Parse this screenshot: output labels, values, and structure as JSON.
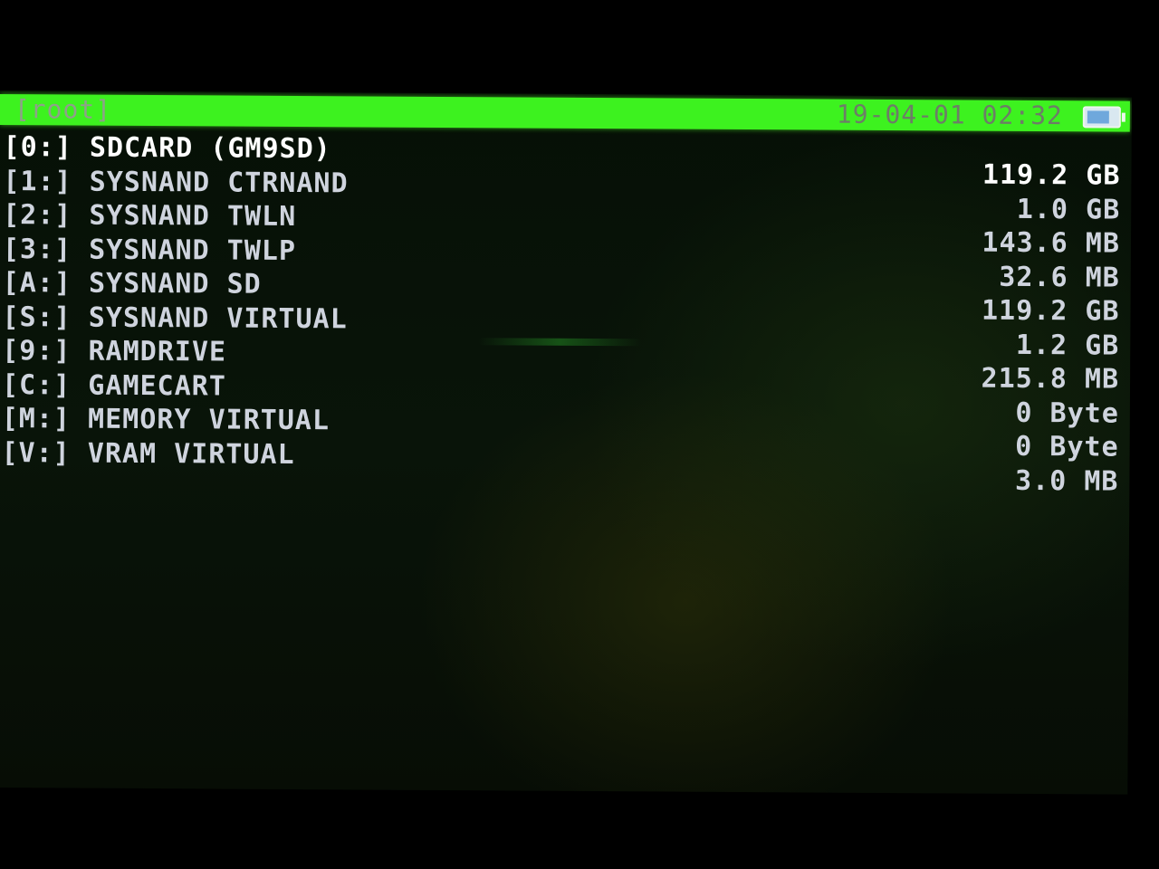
{
  "header": {
    "path": "[root]",
    "datetime": "19-04-01 02:32",
    "battery_icon": "battery-icon",
    "bar_color": "#3df21f"
  },
  "drives": [
    {
      "label": "[0:] SDCARD (GM9SD)",
      "size": "119.2 GB",
      "selected": true
    },
    {
      "label": "[1:] SYSNAND CTRNAND",
      "size": "1.0 GB"
    },
    {
      "label": "[2:] SYSNAND TWLN",
      "size": "143.6 MB"
    },
    {
      "label": "[3:] SYSNAND TWLP",
      "size": "32.6 MB"
    },
    {
      "label": "[A:] SYSNAND SD",
      "size": "119.2 GB"
    },
    {
      "label": "[S:] SYSNAND VIRTUAL",
      "size": "1.2 GB"
    },
    {
      "label": "[9:] RAMDRIVE",
      "size": "215.8 MB"
    },
    {
      "label": "[C:] GAMECART",
      "size": "0 Byte"
    },
    {
      "label": "[M:] MEMORY VIRTUAL",
      "size": "0 Byte"
    },
    {
      "label": "[V:] VRAM VIRTUAL",
      "size": "3.0 MB"
    }
  ]
}
